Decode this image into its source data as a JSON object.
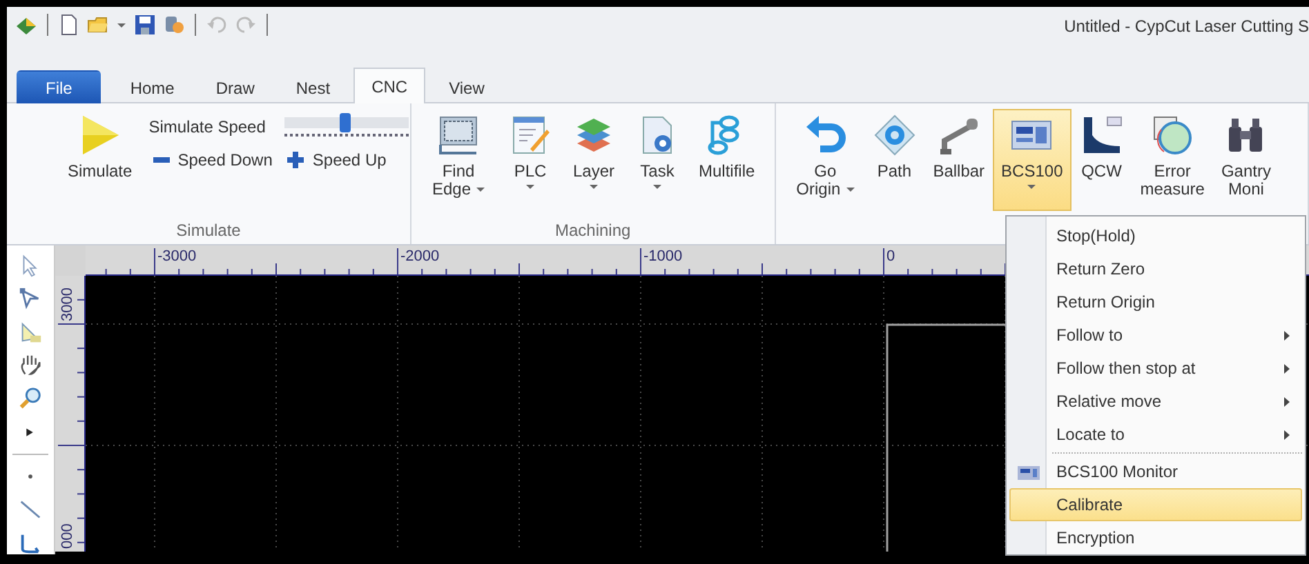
{
  "window": {
    "title": "Untitled - CypCut Laser Cutting S"
  },
  "tabs": [
    {
      "label": "File",
      "kind": "app",
      "selected": false
    },
    {
      "label": "Home",
      "kind": "page",
      "selected": false
    },
    {
      "label": "Draw",
      "kind": "page",
      "selected": false
    },
    {
      "label": "Nest",
      "kind": "page",
      "selected": false
    },
    {
      "label": "CNC",
      "kind": "page",
      "selected": true
    },
    {
      "label": "View",
      "kind": "page",
      "selected": false
    }
  ],
  "ribbon": {
    "groups": [
      {
        "kind": "simulate",
        "label": "Simulate",
        "simulate": {
          "label": "Simulate"
        },
        "speed": {
          "label": "Simulate Speed",
          "level": 0.48
        },
        "small_buttons": [
          {
            "label": "Speed Down"
          },
          {
            "label": "Speed Up"
          }
        ]
      },
      {
        "kind": "buttons",
        "label": "Machining",
        "buttons": [
          {
            "label": "Find Edge",
            "dropdown": true,
            "pressed": false
          },
          {
            "label": "PLC",
            "dropdown": true,
            "pressed": false
          },
          {
            "label": "Layer",
            "dropdown": true,
            "pressed": false
          },
          {
            "label": "Task",
            "dropdown": true,
            "pressed": false
          },
          {
            "label": "Multifile",
            "dropdown": false,
            "pressed": false
          }
        ]
      },
      {
        "kind": "buttons",
        "buttons": [
          {
            "label": "Go Origin",
            "dropdown": true,
            "pressed": false
          },
          {
            "label": "Path",
            "dropdown": false,
            "pressed": false
          },
          {
            "label": "Ballbar",
            "dropdown": false,
            "pressed": false
          },
          {
            "label": "BCS100",
            "dropdown": true,
            "pressed": true
          },
          {
            "label": "QCW",
            "dropdown": false,
            "pressed": false
          },
          {
            "label": "Error measure",
            "dropdown": false,
            "pressed": false
          },
          {
            "label": "Gantry Moni",
            "dropdown": false,
            "pressed": false
          }
        ]
      }
    ]
  },
  "rulers": {
    "top_labels": [
      "-3000",
      "-2000",
      "-1000",
      "0"
    ],
    "left_labels": [
      "3000",
      "000"
    ]
  },
  "menu": {
    "sections": [
      [
        {
          "label": "Stop(Hold)",
          "submenu": false,
          "has_icon": false,
          "selected": false
        },
        {
          "label": "Return Zero",
          "submenu": false,
          "has_icon": false,
          "selected": false
        },
        {
          "label": "Return Origin",
          "submenu": false,
          "has_icon": false,
          "selected": false
        },
        {
          "label": "Follow to",
          "submenu": true,
          "has_icon": false,
          "selected": false
        },
        {
          "label": "Follow then stop at",
          "submenu": true,
          "has_icon": false,
          "selected": false
        },
        {
          "label": "Relative move",
          "submenu": true,
          "has_icon": false,
          "selected": false
        },
        {
          "label": "Locate to",
          "submenu": true,
          "has_icon": false,
          "selected": false
        }
      ],
      [
        {
          "label": "BCS100 Monitor",
          "submenu": false,
          "has_icon": true,
          "selected": false
        },
        {
          "label": "Calibrate",
          "submenu": false,
          "has_icon": false,
          "selected": true
        },
        {
          "label": "Encryption",
          "submenu": false,
          "has_icon": false,
          "selected": false
        }
      ]
    ]
  }
}
